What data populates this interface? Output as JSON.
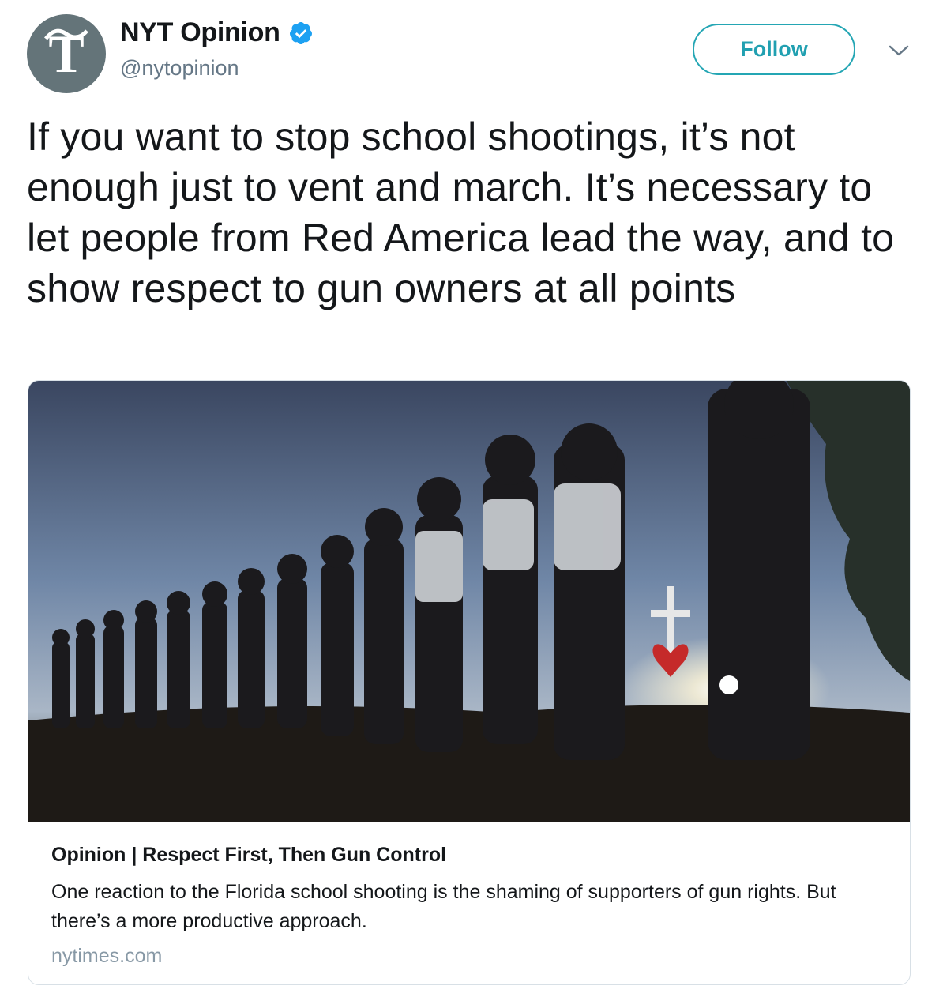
{
  "author": {
    "display_name": "NYT Opinion",
    "handle": "@nytopinion",
    "verified_icon": "verified-badge-icon",
    "avatar_icon": "nyt-t-logo"
  },
  "actions": {
    "follow_label": "Follow",
    "menu_icon": "chevron-down-icon"
  },
  "tweet": {
    "text": "If you want to stop school shootings, it’s not enough just to vent and march. It’s necessary to let people from Red America lead the way, and to show respect to gun owners at all points"
  },
  "card": {
    "title": "Opinion | Respect First, Then Gun Control",
    "description": "One reaction to the Florida school shooting is the shaming of supporters of gun rights. But there’s a more productive approach.",
    "domain": "nytimes.com"
  },
  "colors": {
    "accent": "#24a6b4",
    "verified": "#1da1f2",
    "secondary_text": "#657786",
    "avatar_bg": "#647479"
  }
}
